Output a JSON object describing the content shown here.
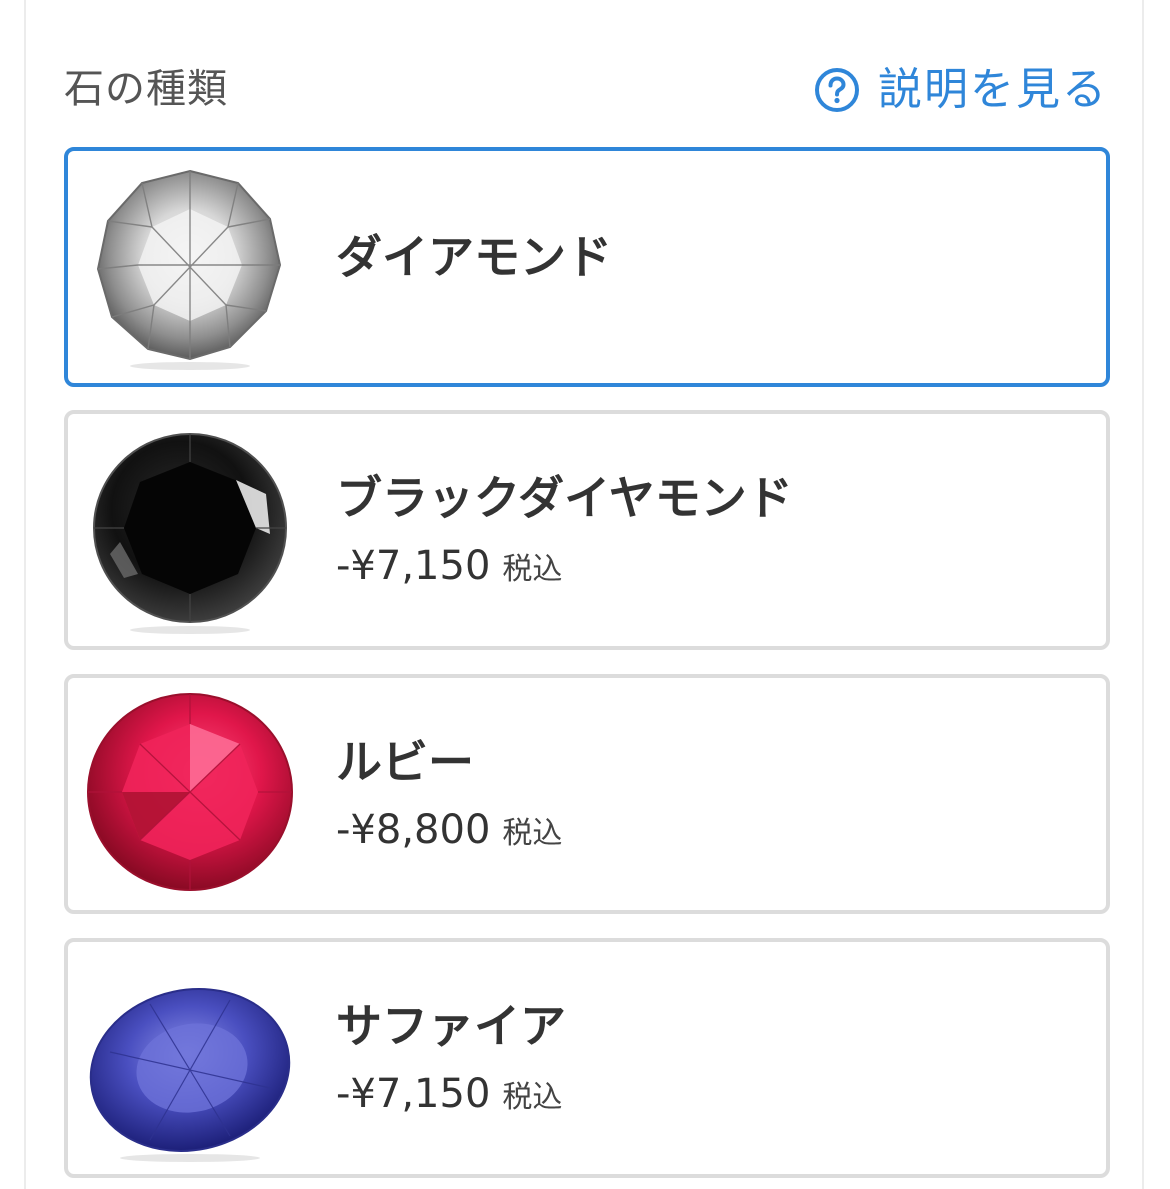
{
  "section": {
    "title": "石の種類",
    "help_label": "説明を見る",
    "help_icon": "question-circle-icon"
  },
  "colors": {
    "accent": "#2f86d9",
    "card_border": "#dcdcdc",
    "text": "#333333"
  },
  "stones": [
    {
      "name": "ダイアモンド",
      "price": "",
      "tax_label": "",
      "selected": true,
      "icon": "diamond-gem-image",
      "color": "#c9c9c9"
    },
    {
      "name": "ブラックダイヤモンド",
      "price": "-¥7,150",
      "tax_label": "税込",
      "selected": false,
      "icon": "black-diamond-gem-image",
      "color": "#1a1a1a"
    },
    {
      "name": "ルビー",
      "price": "-¥8,800",
      "tax_label": "税込",
      "selected": false,
      "icon": "ruby-gem-image",
      "color": "#d81e4a"
    },
    {
      "name": "サファイア",
      "price": "-¥7,150",
      "tax_label": "税込",
      "selected": false,
      "icon": "sapphire-gem-image",
      "color": "#4249b0"
    }
  ]
}
